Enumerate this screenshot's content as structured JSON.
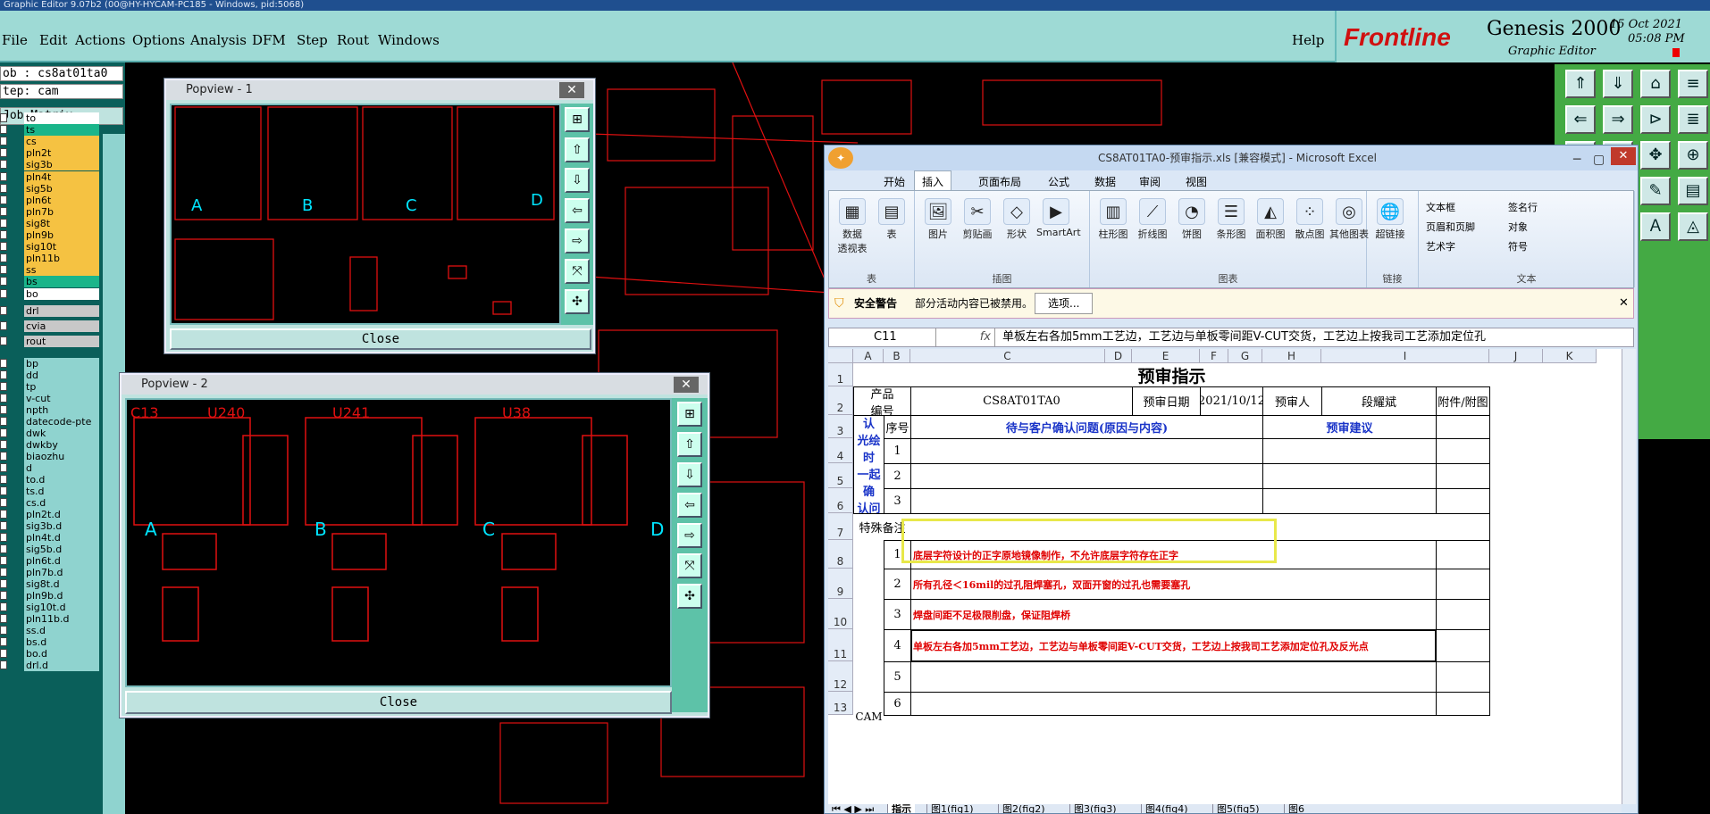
{
  "window": {
    "title": "Graphic Editor 9.07b2 (00@HY-HYCAM-PC185 - Windows, pid:5068)"
  },
  "menu": {
    "items": [
      "File",
      "Edit",
      "Actions",
      "Options",
      "Analysis",
      "DFM",
      "Step",
      "Rout",
      "Windows"
    ],
    "help": "Help"
  },
  "brand": {
    "logo": "Frontline",
    "product": "Genesis 2000",
    "subtitle": "Graphic Editor",
    "date": "15 Oct 2021",
    "time": "05:08 PM"
  },
  "left": {
    "job": "ob : cs8at01ta0",
    "step": "tep: cam",
    "matrix": "Job Matrix ...",
    "layers": [
      {
        "name": "to",
        "color": "#ffffff"
      },
      {
        "name": "ts",
        "color": "#1ab58a"
      },
      {
        "name": "cs",
        "color": "#f5c242"
      },
      {
        "name": "pln2t",
        "color": "#f5c242"
      },
      {
        "name": "sig3b",
        "color": "#f5c242"
      },
      {
        "name": "pln4t",
        "color": "#f5c242"
      },
      {
        "name": "sig5b",
        "color": "#f5c242"
      },
      {
        "name": "pln6t",
        "color": "#f5c242"
      },
      {
        "name": "pln7b",
        "color": "#f5c242"
      },
      {
        "name": "sig8t",
        "color": "#f5c242"
      },
      {
        "name": "pln9b",
        "color": "#f5c242"
      },
      {
        "name": "sig10t",
        "color": "#f5c242"
      },
      {
        "name": "pln11b",
        "color": "#f5c242"
      },
      {
        "name": "ss",
        "color": "#f5c242"
      },
      {
        "name": "bs",
        "color": "#1ab58a"
      },
      {
        "name": "bo",
        "color": "#ffffff"
      },
      {
        "name": "drl",
        "color": "#c8c8c8"
      },
      {
        "name": "cvia",
        "color": "#c8c8c8"
      },
      {
        "name": "rout",
        "color": "#c8c8c8"
      },
      {
        "name": "bp",
        "color": "#8fd3cf"
      },
      {
        "name": "dd",
        "color": "#8fd3cf"
      },
      {
        "name": "tp",
        "color": "#8fd3cf"
      },
      {
        "name": "v-cut",
        "color": "#8fd3cf"
      },
      {
        "name": "npth",
        "color": "#8fd3cf"
      },
      {
        "name": "datecode-pte",
        "color": "#8fd3cf"
      },
      {
        "name": "dwk",
        "color": "#8fd3cf"
      },
      {
        "name": "dwkby",
        "color": "#8fd3cf"
      },
      {
        "name": "biaozhu",
        "color": "#8fd3cf"
      },
      {
        "name": "d",
        "color": "#8fd3cf"
      },
      {
        "name": "to.d",
        "color": "#8fd3cf"
      },
      {
        "name": "ts.d",
        "color": "#8fd3cf"
      },
      {
        "name": "cs.d",
        "color": "#8fd3cf"
      },
      {
        "name": "pln2t.d",
        "color": "#8fd3cf"
      },
      {
        "name": "sig3b.d",
        "color": "#8fd3cf"
      },
      {
        "name": "pln4t.d",
        "color": "#8fd3cf"
      },
      {
        "name": "sig5b.d",
        "color": "#8fd3cf"
      },
      {
        "name": "pln6t.d",
        "color": "#8fd3cf"
      },
      {
        "name": "pln7b.d",
        "color": "#8fd3cf"
      },
      {
        "name": "sig8t.d",
        "color": "#8fd3cf"
      },
      {
        "name": "pln9b.d",
        "color": "#8fd3cf"
      },
      {
        "name": "sig10t.d",
        "color": "#8fd3cf"
      },
      {
        "name": "pln11b.d",
        "color": "#8fd3cf"
      },
      {
        "name": "ss.d",
        "color": "#8fd3cf"
      },
      {
        "name": "bs.d",
        "color": "#8fd3cf"
      },
      {
        "name": "bo.d",
        "color": "#8fd3cf"
      },
      {
        "name": "drl.d",
        "color": "#8fd3cf"
      }
    ]
  },
  "popview1": {
    "title": "Popview - 1",
    "close": "Close",
    "labels": [
      "A",
      "B",
      "C",
      "D"
    ]
  },
  "popview2": {
    "title": "Popview - 2",
    "close": "Close",
    "labels": [
      "A",
      "B",
      "C",
      "D"
    ],
    "parts": [
      "U240",
      "U241",
      "U38",
      "C13"
    ]
  },
  "excel": {
    "title": "CS8AT01TA0-预审指示.xls  [兼容模式] - Microsoft Excel",
    "tabs": [
      "开始",
      "插入",
      "页面布局",
      "公式",
      "数据",
      "审阅",
      "视图"
    ],
    "ribbon": {
      "groups": [
        {
          "title": "表",
          "items": [
            "数据\n透视表",
            "表"
          ]
        },
        {
          "title": "插图",
          "items": [
            "图片",
            "剪贴画",
            "形状",
            "SmartArt"
          ]
        },
        {
          "title": "图表",
          "items": [
            "柱形图",
            "折线图",
            "饼图",
            "条形图",
            "面积图",
            "散点图",
            "其他图表"
          ]
        },
        {
          "title": "链接",
          "items": [
            "超链接"
          ]
        },
        {
          "title": "文本",
          "items": [
            "文本框",
            "签名行",
            "页眉和页脚",
            "对象",
            "艺术字",
            "符号"
          ]
        }
      ]
    },
    "warning": {
      "title": "安全警告",
      "text": "部分活动内容已被禁用。",
      "button": "选项..."
    },
    "namebox": "C11",
    "fx": "fx",
    "formula": "单板左右各加5mm工艺边，工艺边与单板零间距V-CUT交货，工艺边上按我司工艺添加定位孔",
    "columns": [
      "A",
      "B",
      "C",
      "D",
      "E",
      "F",
      "G",
      "H",
      "I",
      "J",
      "K"
    ],
    "rows": [
      "1",
      "2",
      "3",
      "4",
      "5",
      "6",
      "7",
      "8",
      "9",
      "10",
      "11",
      "12",
      "13"
    ],
    "sheet": {
      "heading": "预审指示",
      "product_label": "产品\n编号",
      "product_no": "CS8AT01TA0",
      "date_label": "预审日期",
      "date": "2021/10/12",
      "reviewer_label": "预审人",
      "reviewer": "段耀斌",
      "attach_label": "附件/附图",
      "confirm_label": "待确认\n光绘时\n一起确\n认问题",
      "seq_label": "序号",
      "issue_header": "待与客户确认问题(原因与内容)",
      "suggest_header": "预审建议",
      "confirm_seq": [
        "1",
        "2",
        "3"
      ],
      "special_label": "特殊备注",
      "notes": [
        {
          "no": "1",
          "text": "底层字符设计的正字原地镜像制作，不允许底层字符存在正字"
        },
        {
          "no": "2",
          "text": "所有孔径＜16mil的过孔阻焊塞孔，双面开窗的过孔也需要塞孔"
        },
        {
          "no": "3",
          "text": "焊盘间距不足极限削盘，保证阻焊桥"
        },
        {
          "no": "4",
          "text": "单板左右各加5mm工艺边，工艺边与单板零间距V-CUT交货，工艺边上按我司工艺添加定位孔及反光点"
        },
        {
          "no": "5",
          "text": ""
        },
        {
          "no": "6",
          "text": ""
        }
      ],
      "cam_label": "CAM"
    },
    "sheettabs": [
      "指示",
      "图1(fig1)",
      "图2(fig2)",
      "图3(fig3)",
      "图4(fig4)",
      "图5(fig5)",
      "图6"
    ]
  }
}
